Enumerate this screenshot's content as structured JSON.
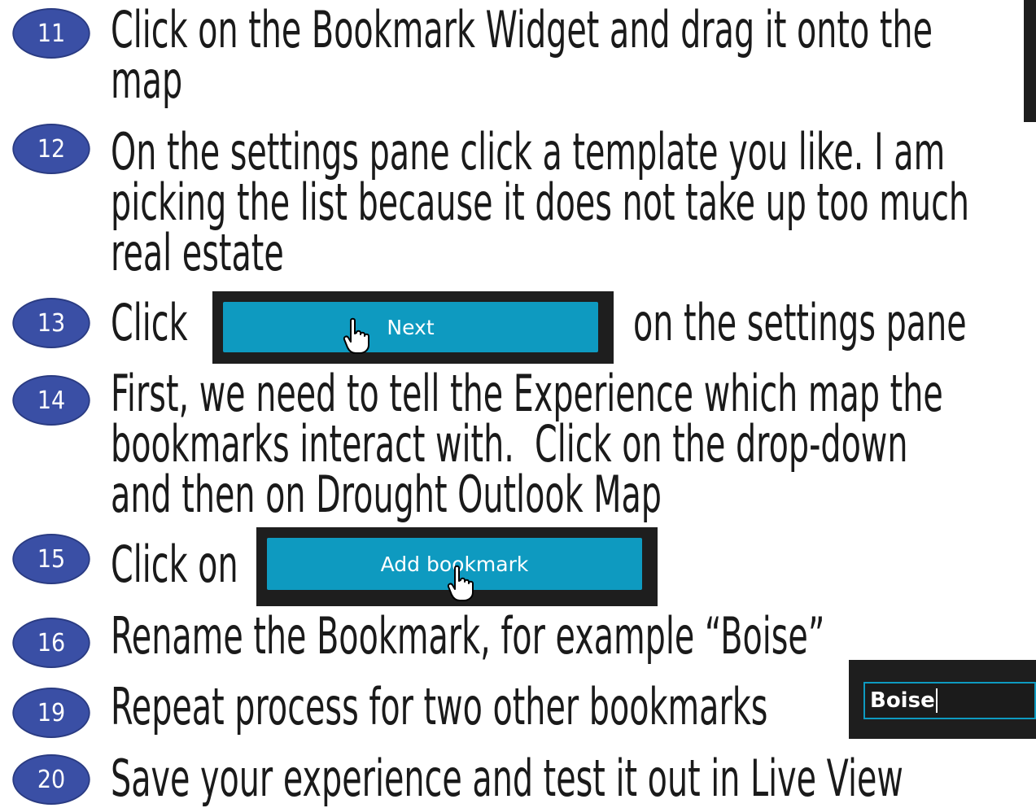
{
  "steps": [
    {
      "number": "11",
      "text": "Click on the Bookmark Widget and drag it onto the\nmap"
    },
    {
      "number": "12",
      "text": "On the settings pane click a template you like. I am\npicking the list because it does not take up too much\nreal estate"
    },
    {
      "number": "13",
      "text_before": "Click",
      "text_after": "on the settings pane"
    },
    {
      "number": "14",
      "text": "First, we need to tell the Experience which map the\nbookmarks interact with.  Click on the drop-down\nand then on Drought Outlook Map"
    },
    {
      "number": "15",
      "text_before": "Click on"
    },
    {
      "number": "16",
      "text": "Rename the Bookmark, for example “Boise”"
    },
    {
      "number": "19",
      "text": "Repeat process for two other bookmarks"
    },
    {
      "number": "20",
      "text": "Save your experience and test it out in Live View"
    }
  ],
  "buttons": {
    "next_label": "Next",
    "add_bookmark_label": "Add bookmark"
  },
  "input": {
    "value": "Boise"
  },
  "icons": {
    "cursor": "hand-pointer-icon"
  },
  "colors": {
    "badge": "#3a4fa5",
    "button": "#0e9ac0",
    "screenshot_frame": "#1e1e1e"
  }
}
